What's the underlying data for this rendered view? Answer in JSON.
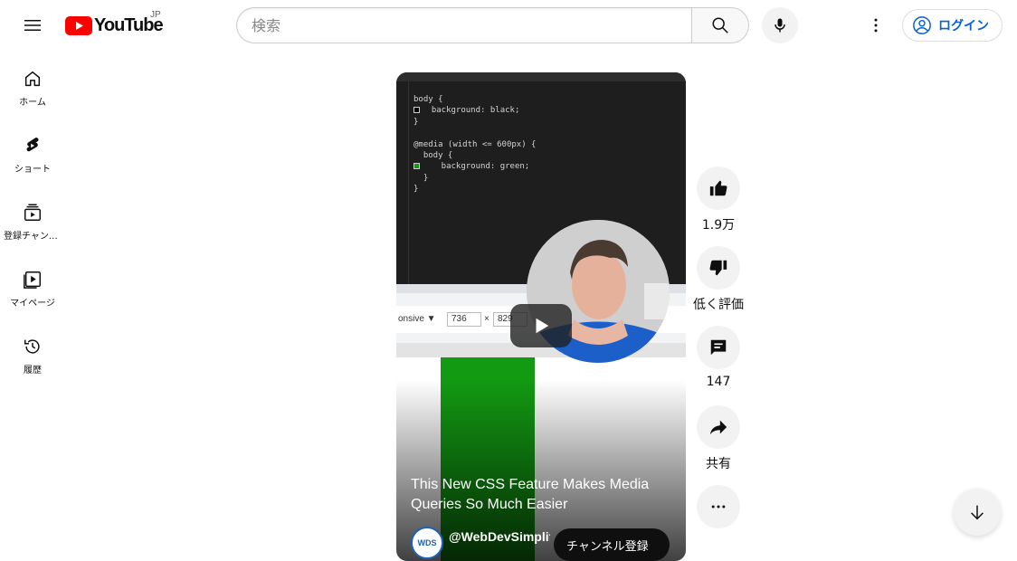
{
  "header": {
    "logo_text": "YouTube",
    "region": "JP",
    "search_placeholder": "検索",
    "login_label": "ログイン"
  },
  "sidebar": {
    "items": [
      {
        "label": "ホーム",
        "icon": "home-icon"
      },
      {
        "label": "ショート",
        "icon": "shorts-icon"
      },
      {
        "label": "登録チャンネル",
        "icon": "subscriptions-icon"
      },
      {
        "label": "マイページ",
        "icon": "library-icon"
      },
      {
        "label": "履歴",
        "icon": "history-icon"
      }
    ]
  },
  "video": {
    "title": "This New CSS Feature Makes Media Queries So Much Easier",
    "channel_handle": "@WebDevSimplified",
    "channel_avatar_text": "WDS",
    "subscribe_label": "チャンネル登録",
    "code_lines": [
      "body {",
      "  background: black;",
      "}",
      "",
      "@media (width <= 600px) {",
      "  body {",
      "    background: green;",
      "  }",
      "}"
    ],
    "browser_device": "onsive ▼",
    "browser_width": "736",
    "browser_x": "×",
    "browser_height": "829"
  },
  "actions": {
    "like_count": "1.9万",
    "dislike_label": "低く評価",
    "comment_count": "147",
    "share_label": "共有"
  },
  "colors": {
    "brand_red": "#ff0000",
    "link_blue": "#065fd4",
    "code_green": "#129a12"
  }
}
